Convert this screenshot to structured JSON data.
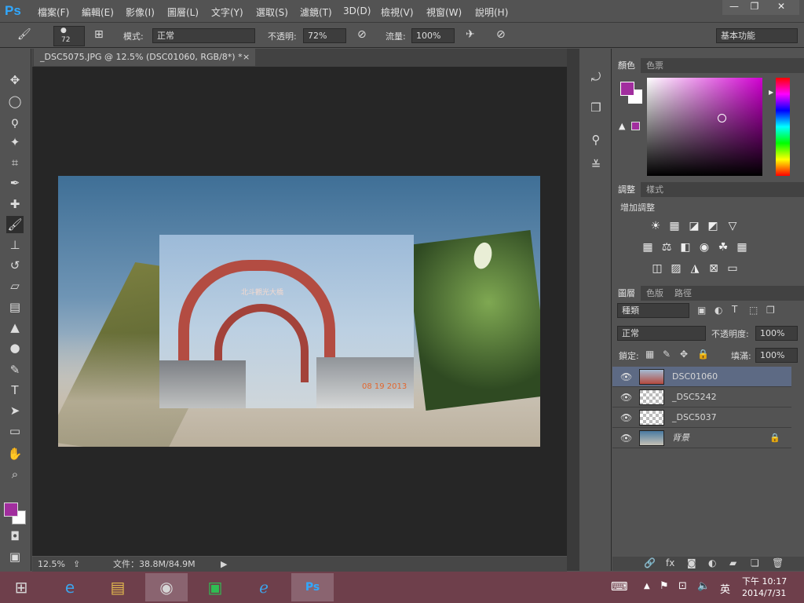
{
  "app": {
    "logo": "Ps"
  },
  "menu": [
    "檔案(F)",
    "編輯(E)",
    "影像(I)",
    "圖層(L)",
    "文字(Y)",
    "選取(S)",
    "濾鏡(T)",
    "3D(D)",
    "檢視(V)",
    "視窗(W)",
    "說明(H)"
  ],
  "window_controls": {
    "minimize": "—",
    "restore": "❐",
    "close": "✕"
  },
  "options": {
    "brush_size": "72",
    "mode_label": "模式:",
    "mode_value": "正常",
    "opacity_label": "不透明:",
    "opacity_value": "72%",
    "flow_label": "流量:",
    "flow_value": "100%",
    "workspace": "基本功能"
  },
  "document": {
    "tab_title": "_DSC5075.JPG @ 12.5% (DSC01060, RGB/8*) *",
    "tab_close": "×",
    "date_stamp": "08 19 2013",
    "bridge_sign": "北斗觀光大橋"
  },
  "status": {
    "zoom": "12.5%",
    "doc_size": "文件：38.8M/84.9M"
  },
  "color_panel": {
    "tabs": [
      "顏色",
      "色票"
    ],
    "fg_color": "#a12e9e",
    "bg_color": "#ffffff"
  },
  "adjust_panel": {
    "tabs": [
      "調整",
      "樣式"
    ],
    "title": "增加調整"
  },
  "layers_panel": {
    "tabs": [
      "圖層",
      "色版",
      "路徑"
    ],
    "filter_kind": "種類",
    "blend_mode": "正常",
    "opacity_label": "不透明度:",
    "opacity_value": "100%",
    "lock_label": "鎖定:",
    "fill_label": "填滿:",
    "fill_value": "100%",
    "layers": [
      {
        "name": "DSC01060",
        "selected": true
      },
      {
        "name": "_DSC5242",
        "selected": false
      },
      {
        "name": "_DSC5037",
        "selected": false
      },
      {
        "name": "背景",
        "selected": false,
        "locked": true
      }
    ],
    "footer_icons": [
      "link-icon",
      "fx-icon",
      "mask-icon",
      "adjustment-icon",
      "folder-icon",
      "new-layer-icon",
      "trash-icon"
    ]
  },
  "taskbar": {
    "apps": [
      "start-icon",
      "internet-explorer-icon",
      "file-explorer-icon",
      "chrome-icon",
      "store-icon",
      "ie-alt-icon",
      "photoshop-icon"
    ],
    "ime": "英",
    "time": "下午 10:17",
    "date": "2014/7/31"
  }
}
